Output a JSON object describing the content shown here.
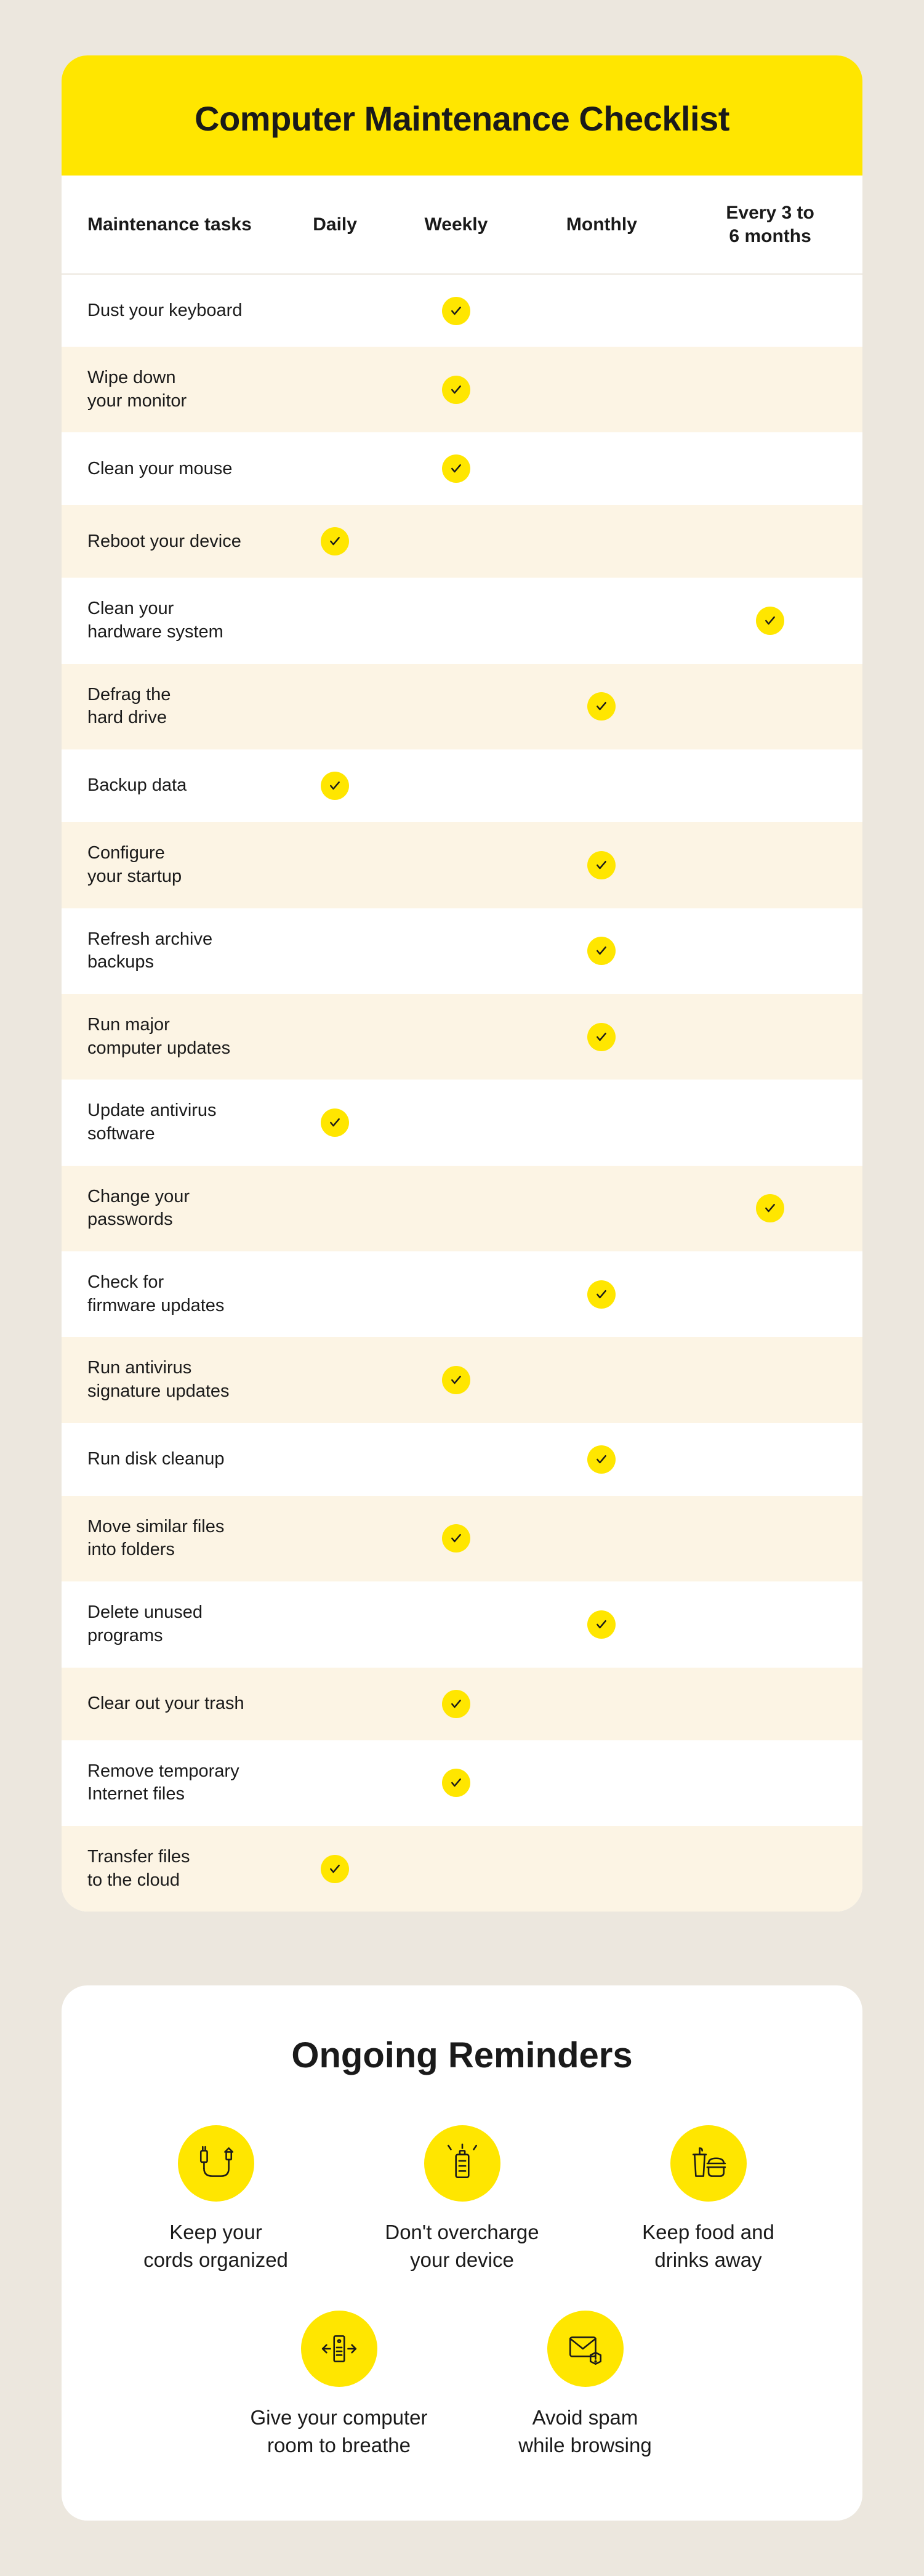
{
  "checklist": {
    "title": "Computer Maintenance Checklist",
    "columns": [
      "Maintenance tasks",
      "Daily",
      "Weekly",
      "Monthly",
      "Every 3 to 6 months"
    ],
    "rows": [
      {
        "task": "Dust your keyboard",
        "freq": "Weekly"
      },
      {
        "task": "Wipe down your monitor",
        "freq": "Weekly"
      },
      {
        "task": "Clean your mouse",
        "freq": "Weekly"
      },
      {
        "task": "Reboot your device",
        "freq": "Daily"
      },
      {
        "task": "Clean your hardware system",
        "freq": "Every 3 to 6 months"
      },
      {
        "task": "Defrag the hard drive",
        "freq": "Monthly"
      },
      {
        "task": "Backup data",
        "freq": "Daily"
      },
      {
        "task": "Configure your startup",
        "freq": "Monthly"
      },
      {
        "task": "Refresh archive backups",
        "freq": "Monthly"
      },
      {
        "task": "Run major computer updates",
        "freq": "Monthly"
      },
      {
        "task": "Update antivirus software",
        "freq": "Daily"
      },
      {
        "task": "Change your passwords",
        "freq": "Every 3 to 6 months"
      },
      {
        "task": "Check for firmware updates",
        "freq": "Monthly"
      },
      {
        "task": "Run antivirus signature updates",
        "freq": "Weekly"
      },
      {
        "task": "Run disk cleanup",
        "freq": "Monthly"
      },
      {
        "task": "Move similar files into folders",
        "freq": "Weekly"
      },
      {
        "task": "Delete unused programs",
        "freq": "Monthly"
      },
      {
        "task": "Clear out your trash",
        "freq": "Weekly"
      },
      {
        "task": "Remove temporary Internet files",
        "freq": "Weekly"
      },
      {
        "task": "Transfer files to the cloud",
        "freq": "Daily"
      }
    ],
    "task_breaks": {
      "Wipe down your monitor": "Wipe down\nyour monitor",
      "Clean your hardware system": "Clean your\nhardware system",
      "Defrag the hard drive": "Defrag the\nhard drive",
      "Configure your startup": "Configure\nyour startup",
      "Refresh archive backups": "Refresh archive\nbackups",
      "Run major computer updates": "Run major\ncomputer updates",
      "Update antivirus software": "Update antivirus\nsoftware",
      "Change your passwords": "Change your\npasswords",
      "Check for firmware updates": "Check for\nfirmware updates",
      "Run antivirus signature updates": "Run antivirus\nsignature updates",
      "Move similar files into folders": "Move similar files\ninto folders",
      "Delete unused programs": "Delete unused\nprograms",
      "Remove temporary Internet files": "Remove temporary\nInternet files",
      "Transfer files to the cloud": "Transfer files\nto the cloud"
    }
  },
  "reminders": {
    "title": "Ongoing Reminders",
    "items": [
      {
        "icon": "cords-icon",
        "label": "Keep your\ncords organized"
      },
      {
        "icon": "battery-icon",
        "label": "Don't overcharge\nyour device"
      },
      {
        "icon": "food-icon",
        "label": "Keep food and\ndrinks away"
      },
      {
        "icon": "airflow-icon",
        "label": "Give your computer\nroom to breathe"
      },
      {
        "icon": "spam-icon",
        "label": "Avoid spam\nwhile browsing"
      }
    ]
  }
}
